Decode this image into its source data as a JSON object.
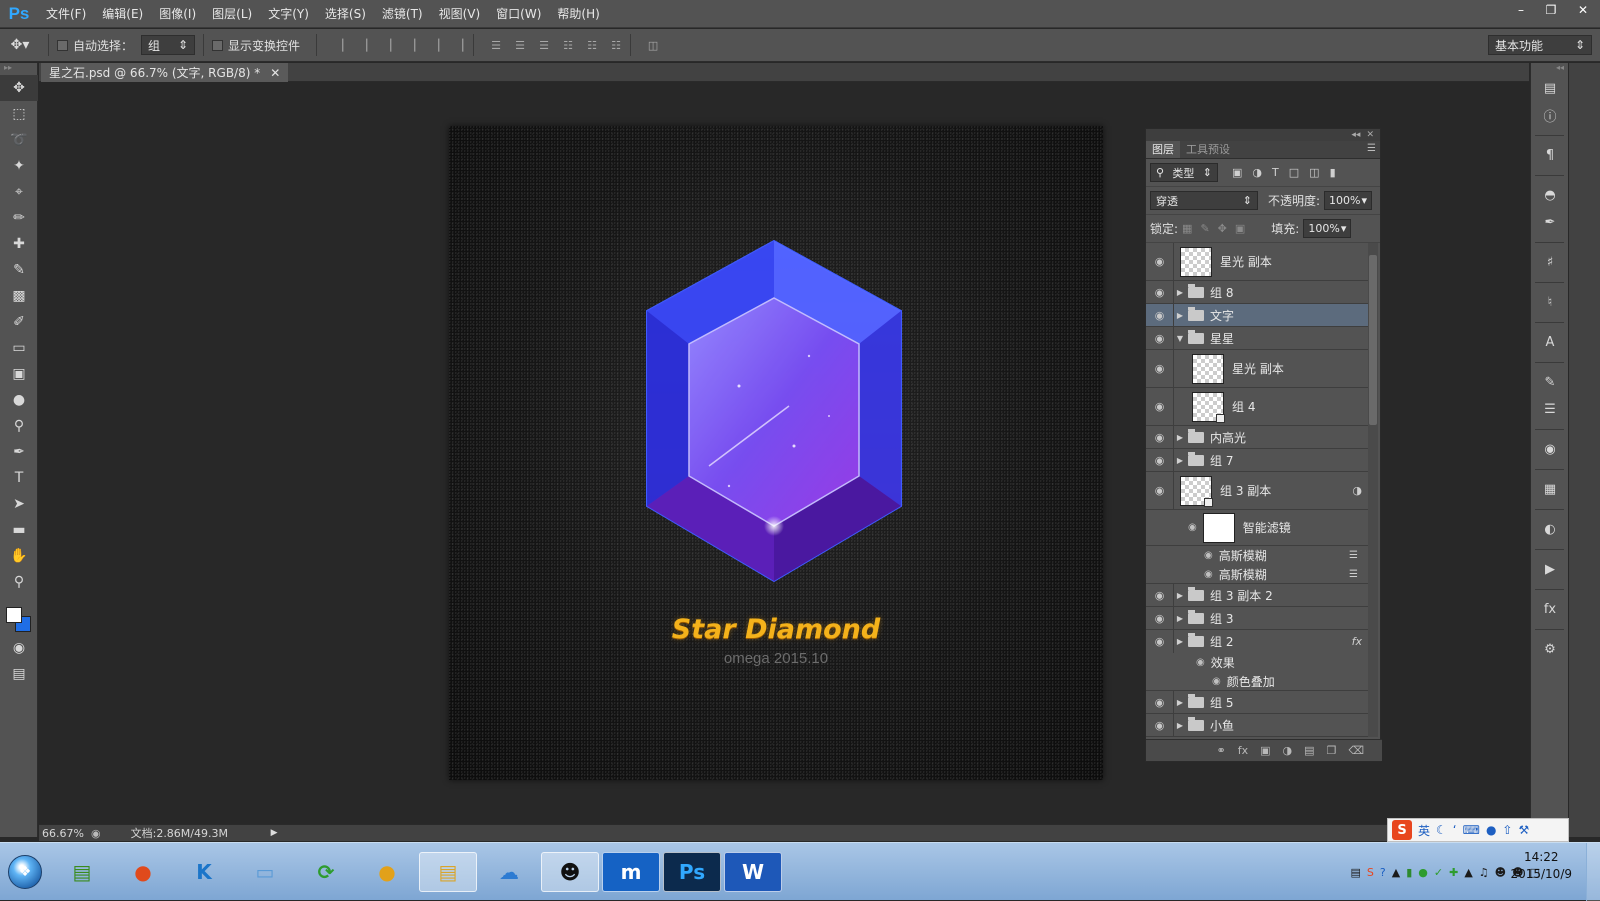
{
  "app": {
    "logo": "Ps",
    "menus": [
      "文件(F)",
      "编辑(E)",
      "图像(I)",
      "图层(L)",
      "文字(Y)",
      "选择(S)",
      "滤镜(T)",
      "视图(V)",
      "窗口(W)",
      "帮助(H)"
    ],
    "window_controls": [
      "minimize-icon",
      "restore-icon",
      "close-icon"
    ]
  },
  "options_bar": {
    "auto_select_label": "自动选择：",
    "auto_select_checked": false,
    "auto_select_value": "组",
    "show_transform_label": "显示变换控件",
    "show_transform_checked": false,
    "workspace": "基本功能"
  },
  "document": {
    "tab_title": "星之石.psd @ 66.7% (文字, RGB/8) *",
    "artwork_title": "Star Diamond",
    "artwork_subtitle": "omega 2015.10"
  },
  "layers_panel": {
    "tabs": [
      "图层",
      "工具预设"
    ],
    "active_tab": "图层",
    "filter_kind": "类型",
    "blend_mode": "穿透",
    "opacity_label": "不透明度:",
    "opacity_value": "100%",
    "lock_label": "锁定:",
    "fill_label": "填充:",
    "fill_value": "100%",
    "layers": [
      {
        "name": "星光 副本",
        "type": "layer",
        "indent": 0
      },
      {
        "name": "组 8",
        "type": "group",
        "expanded": false,
        "indent": 0
      },
      {
        "name": "文字",
        "type": "group",
        "expanded": false,
        "indent": 0,
        "selected": true
      },
      {
        "name": "星星",
        "type": "group",
        "expanded": true,
        "indent": 0
      },
      {
        "name": "星光 副本",
        "type": "layer",
        "indent": 1
      },
      {
        "name": "组 4",
        "type": "smart",
        "indent": 1
      },
      {
        "name": "内高光",
        "type": "group",
        "expanded": false,
        "indent": 0
      },
      {
        "name": "组 7",
        "type": "group",
        "expanded": false,
        "indent": 0
      },
      {
        "name": "组 3 副本",
        "type": "smart",
        "indent": 0
      },
      {
        "name": "智能滤镜",
        "type": "smart-filter",
        "indent": 1
      },
      {
        "name": "高斯模糊",
        "type": "filter",
        "indent": 2
      },
      {
        "name": "高斯模糊",
        "type": "filter",
        "indent": 2
      },
      {
        "name": "组 3 副本 2",
        "type": "group",
        "expanded": false,
        "indent": 0
      },
      {
        "name": "组 3",
        "type": "group",
        "expanded": false,
        "indent": 0
      },
      {
        "name": "组 2",
        "type": "group",
        "expanded": false,
        "indent": 0,
        "fx": true
      },
      {
        "name": "效果",
        "type": "effects",
        "indent": 1
      },
      {
        "name": "颜色叠加",
        "type": "effect",
        "indent": 2
      },
      {
        "name": "组 5",
        "type": "group",
        "expanded": false,
        "indent": 0
      },
      {
        "name": "小鱼",
        "type": "group",
        "expanded": false,
        "indent": 0
      }
    ]
  },
  "status": {
    "zoom": "66.67%",
    "doc_info": "文档:2.86M/49.3M"
  },
  "ime": {
    "logo": "S",
    "mode": "英"
  },
  "taskbar": {
    "time": "14:22",
    "date": "2015/10/9",
    "apps": [
      "notepad-icon",
      "balloon-icon",
      "k-icon",
      "bluebook-icon",
      "refresh-green-icon",
      "orange-ball-icon",
      "file-explorer-icon",
      "baidu-cloud-icon",
      "qq-icon",
      "maxthon-icon",
      "photoshop-icon",
      "wps-writer-icon"
    ]
  },
  "colors": {
    "accent": "#31a8ff",
    "foreground_swatch": "#ffffff",
    "background_swatch": "#1f6ee6",
    "title_gold": "#f4b21b"
  }
}
